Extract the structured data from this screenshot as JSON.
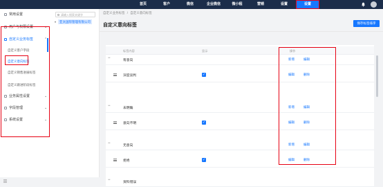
{
  "topnav": {
    "items": [
      "首页",
      "客户",
      "微信",
      "企业微信",
      "微小程",
      "营销",
      "设置",
      "设置"
    ],
    "active_index": 7
  },
  "sidebar": {
    "items": [
      {
        "label": "常用设置"
      },
      {
        "label": "用户与权限设置"
      },
      {
        "label": "自定义业务标签"
      },
      {
        "label": "业务属性设置"
      },
      {
        "label": "字段管理"
      },
      {
        "label": "系统设置"
      }
    ],
    "sub_items": [
      "自定义客户字段",
      "自定义意向标签",
      "自定义销售进展标签",
      "自定义跟进阶段标签"
    ]
  },
  "tree": {
    "search_placeholder": "请输入搜索关键字",
    "node_label": "亚太国际管理有限公司"
  },
  "main": {
    "breadcrumb": [
      "自定义业务标签",
      "/",
      "自定义意向标签"
    ],
    "title": "自定义意向标签",
    "save_label": "保存标签排序"
  },
  "table": {
    "headers": [
      "标签内容",
      "显示",
      "操作"
    ],
    "groups": [
      {
        "name": "有意向",
        "sub": "深度谈判",
        "actions": [
          "新增",
          "编辑"
        ],
        "sub_actions": [
          "编辑",
          "删除"
        ]
      },
      {
        "name": "未明确",
        "sub": "意向不明",
        "actions": [
          "新增",
          "编辑"
        ],
        "sub_actions": [
          "编辑",
          "删除"
        ]
      },
      {
        "name": "无意向",
        "sub": "拒绝",
        "actions": [
          "新增",
          "编辑"
        ],
        "sub_actions": [
          "编辑",
          "删除"
        ]
      },
      {
        "name": "资料错误"
      }
    ]
  },
  "colors": {
    "accent": "#1677ff",
    "nav": "#1b2d4a",
    "highlight": "#e60012"
  }
}
